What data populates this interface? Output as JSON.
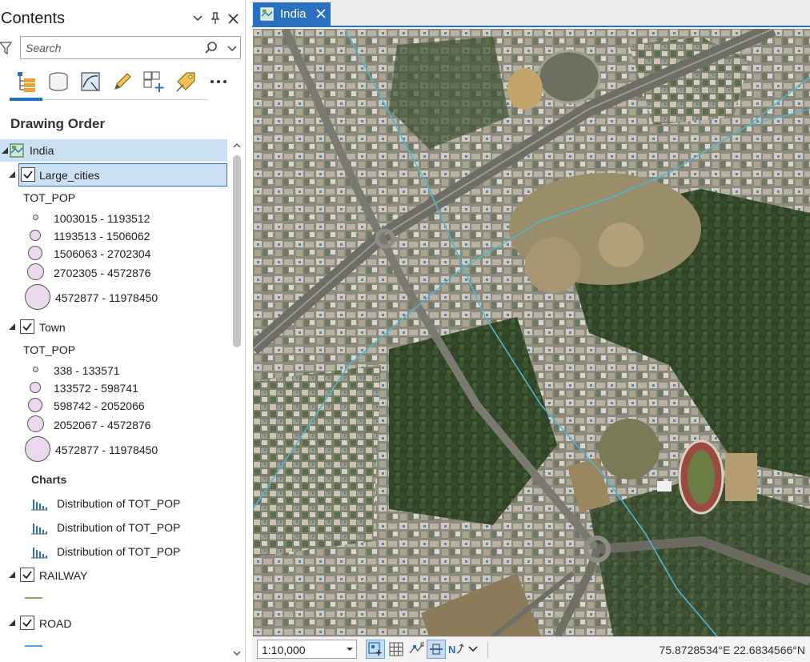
{
  "contents": {
    "title": "Contents",
    "search": {
      "placeholder": "Search"
    },
    "toolbar_icons": [
      "list-by-drawing-order-icon",
      "list-by-data-source-icon",
      "list-by-selection-icon",
      "list-by-editing-icon",
      "list-by-snapping-icon",
      "list-by-labeling-icon",
      "more-icon"
    ],
    "section_heading": "Drawing Order",
    "map": {
      "name": "India"
    },
    "layers": [
      {
        "name": "Large_cities",
        "checked": true,
        "field": "TOT_POP",
        "classes": [
          "1003015 - 1193512",
          "1193513 - 1506062",
          "1506063 - 2702304",
          "2702305 - 4572876",
          "4572877 - 11978450"
        ]
      },
      {
        "name": "Town",
        "checked": true,
        "field": "TOT_POP",
        "classes": [
          "338 - 133571",
          "133572 - 598741",
          "598742 - 2052066",
          "2052067 - 4572876",
          "4572877 - 11978450"
        ],
        "charts_heading": "Charts",
        "charts": [
          "Distribution of TOT_POP",
          "Distribution of TOT_POP",
          "Distribution of TOT_POP"
        ]
      },
      {
        "name": "RAILWAY",
        "checked": true,
        "swatch_color": "#8aa66a"
      },
      {
        "name": "ROAD",
        "checked": true,
        "swatch_color": "#4da6d9"
      }
    ],
    "symbol_fill": "#ead8ec"
  },
  "map_view": {
    "tab_label": "India",
    "scale": "1:10,000",
    "coordinates": "75.8728534°E 22.6834566°N",
    "water_line_color": "#4fb6cf"
  },
  "colors": {
    "accent": "#2a70c0",
    "selected_row": "#cce0f4"
  }
}
